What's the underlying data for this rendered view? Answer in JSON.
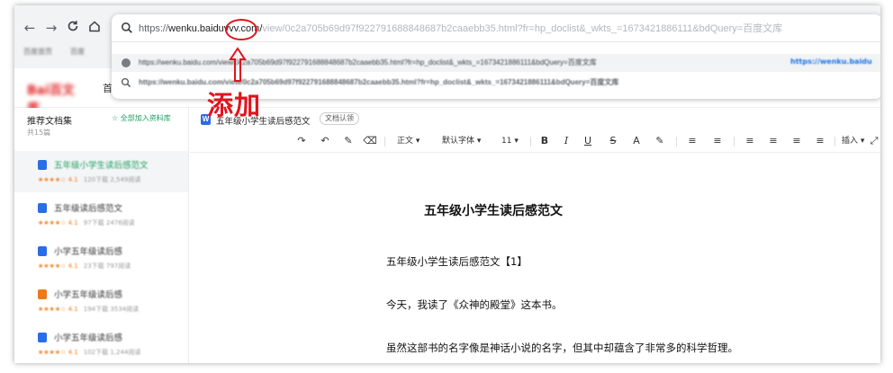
{
  "browser": {
    "url": {
      "protocol": "https://",
      "host": "wenku.baiduvvv.com/",
      "rest": "view/0c2a705b69d97f922791688848687b2caaebb35.html?fr=hp_doclist&_wkts_=1673421886111&bdQuery=百度文库"
    },
    "suggestions": [
      {
        "text": "https://wenku.baidu.com/view/0c2a705b69d97f922791688848687b2caaebb35.html?fr=hp_doclist&_wkts_=1673421886111&bdQuery=百度文库",
        "link": "https://wenku.baidu"
      },
      {
        "text": "https://wenku.baidu.com/view/0c2a705b69d97f922791688848687b2caaebb35.html?fr=hp_doclist&_wkts_=1673421886111&bdQuery=百度文库"
      }
    ],
    "bookmarks": [
      "百度首页",
      "百度"
    ],
    "icons": {
      "back": "arrow-left-icon",
      "forward": "arrow-right-icon",
      "reload": "reload-icon",
      "home": "home-icon"
    }
  },
  "annotation": {
    "text": "添加",
    "color": "#e0141e"
  },
  "site": {
    "logo_text": "Bai百文库",
    "nav_first": "首"
  },
  "sidebar": {
    "title": "推荐文档集",
    "count": "共15篇",
    "add_all": "全部加入资料库",
    "items": [
      {
        "title": "五年级小学生读后感范文",
        "rating": "★★★★☆ 4.1",
        "stats": "120下载  2,549阅读",
        "icon_color": "#2b6de6",
        "active": true
      },
      {
        "title": "五年级读后感范文",
        "rating": "★★★★☆ 4.1",
        "stats": "97下载  2476阅读",
        "icon_color": "#2b6de6",
        "active": false
      },
      {
        "title": "小学五年级读后感",
        "rating": "★★★★☆ 4.1",
        "stats": "23下载  797阅读",
        "icon_color": "#2b6de6",
        "active": false
      },
      {
        "title": "小学五年级读后感",
        "rating": "★★★★☆ 4.1",
        "stats": "194下载  3534阅读",
        "icon_color": "#f07a1a",
        "active": false
      },
      {
        "title": "小学五年级读后感",
        "rating": "★★★★☆ 4.1",
        "stats": "102下载  1,244阅读",
        "icon_color": "#2b6de6",
        "active": false
      }
    ]
  },
  "document": {
    "name": "五年级小学生读后感范文",
    "badge": "文档认领",
    "heading": "五年级小学生读后感范文",
    "paragraphs": [
      "五年级小学生读后感范文【1】",
      "今天，我读了《众神的殿堂》这本书。",
      "虽然这部书的名字像是神话小说的名字，但其中却蕴含了非常多的科学哲理。"
    ]
  },
  "toolbar": {
    "style": "正文",
    "font": "默认字体",
    "size": "11",
    "insert": "插入",
    "bold": "B",
    "italic": "I",
    "underline": "U",
    "strike": "S",
    "font_color": "A"
  }
}
